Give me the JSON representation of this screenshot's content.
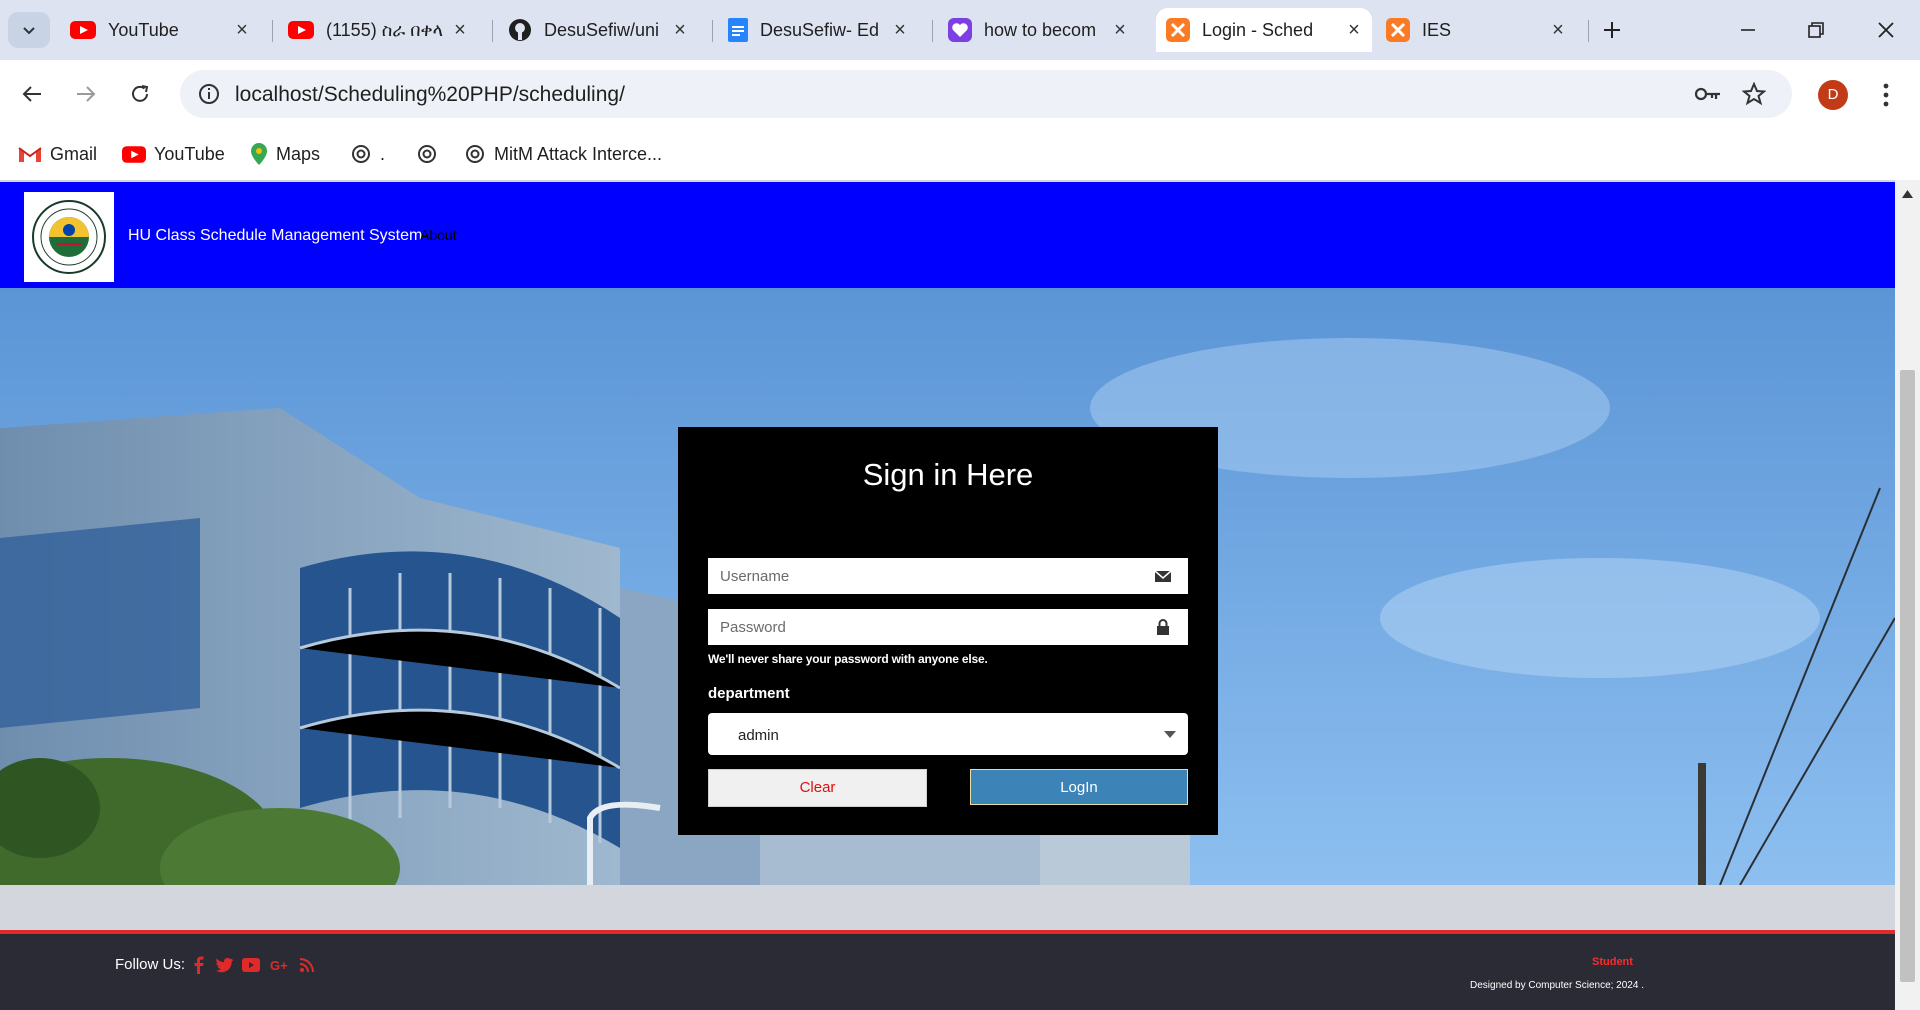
{
  "browser": {
    "tabs": [
      {
        "title": "YouTube",
        "icon": "youtube-icon"
      },
      {
        "title": "(1155) ስራ በቀላ",
        "icon": "youtube-icon"
      },
      {
        "title": "DesuSefiw/uni",
        "icon": "github-icon"
      },
      {
        "title": "DesuSefiw- Ed",
        "icon": "docs-icon"
      },
      {
        "title": "how to becom",
        "icon": "heart-icon"
      },
      {
        "title": "Login - Sched",
        "icon": "xampp-icon",
        "active": true
      },
      {
        "title": "IES",
        "icon": "xampp-icon"
      }
    ],
    "url": "localhost/Scheduling%20PHP/scheduling/",
    "profile_initial": "D",
    "bookmarks": [
      {
        "label": "Gmail",
        "icon": "gmail-icon"
      },
      {
        "label": "YouTube",
        "icon": "youtube-icon"
      },
      {
        "label": "Maps",
        "icon": "maps-icon"
      },
      {
        "label": ".",
        "icon": "openai-icon"
      },
      {
        "label": "",
        "icon": "openai-icon"
      },
      {
        "label": "MitM Attack Interce...",
        "icon": "openai-icon"
      }
    ]
  },
  "header": {
    "title": "HU Class Schedule Management System",
    "about": "About"
  },
  "login": {
    "heading": "Sign in Here",
    "username_placeholder": "Username",
    "password_placeholder": "Password",
    "hint": "We'll never share your password with anyone else.",
    "department_label": "department",
    "department_value": "admin",
    "clear_label": "Clear",
    "login_label": "LogIn"
  },
  "footer": {
    "follow": "Follow Us:",
    "social_icons": [
      "facebook-icon",
      "twitter-icon",
      "youtube-icon",
      "google-plus-icon",
      "rss-icon"
    ],
    "student": "Student",
    "credit": "Designed by Computer Science; 2024 ."
  },
  "colors": {
    "header_bg": "#0000ff",
    "login_button": "#3c83b8",
    "clear_text": "#e01010",
    "footer_bg": "#2b2b36",
    "footer_accent": "#e02a2a",
    "social": "#e02a2a"
  }
}
